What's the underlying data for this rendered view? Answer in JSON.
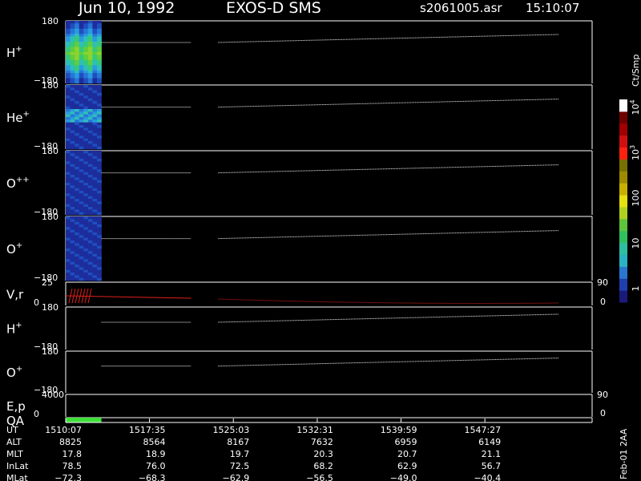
{
  "header": {
    "date": "Jun 10, 1992",
    "instrument": "EXOS-D SMS",
    "file": "s2061005.asr",
    "time": "15:10:07"
  },
  "chart_data": {
    "type": "heatmap",
    "panels": [
      {
        "label": "H",
        "sup": "+",
        "top_tick": "180",
        "bottom_tick": "−180"
      },
      {
        "label": "He",
        "sup": "+",
        "top_tick": "180",
        "bottom_tick": "−180"
      },
      {
        "label": "O",
        "sup": "++",
        "top_tick": "180",
        "bottom_tick": "−180"
      },
      {
        "label": "O",
        "sup": "+",
        "top_tick": "180",
        "bottom_tick": "−180"
      },
      {
        "label": "V,r",
        "sup": "",
        "top_tick": "25",
        "bottom_tick": "0",
        "right_top": "90",
        "right_bottom": "0"
      },
      {
        "label": "H",
        "sup": "+",
        "top_tick": "180",
        "bottom_tick": "−180"
      },
      {
        "label": "O",
        "sup": "+",
        "top_tick": "180",
        "bottom_tick": "−180"
      },
      {
        "label": "E,p",
        "sup": "",
        "top_tick": "4000",
        "bottom_tick": "0",
        "right_top": "90",
        "right_bottom": "0"
      },
      {
        "label": "QA",
        "sup": "",
        "top_tick": "",
        "bottom_tick": ""
      }
    ],
    "colorbar": {
      "unit": "Ct/Smp",
      "ticks": [
        {
          "value": 1,
          "label": "1"
        },
        {
          "value": 10,
          "label": "10"
        },
        {
          "value": 100,
          "label": "100"
        },
        {
          "value": 1000,
          "label": "10",
          "exp": "3"
        },
        {
          "value": 10000,
          "label": "10",
          "exp": "4"
        }
      ],
      "range": [
        0.5,
        15000
      ]
    },
    "time_axis": {
      "range_min": [
        1510.12,
        1557.0
      ],
      "data_range_min": [
        1510.12,
        1554.0
      ],
      "gap_min": [
        1521.3,
        1523.7
      ],
      "heatmap_end_min": [
        1510.12,
        1513.3
      ]
    },
    "ephemeris": {
      "rows": [
        "UT",
        "ALT",
        "MLT",
        "InLat",
        "MLat"
      ],
      "ticks_min": [
        1510.12,
        1517.58,
        1525.05,
        1532.52,
        1539.98,
        1547.45
      ],
      "columns": [
        {
          "UT": "1510:07",
          "ALT": "8825",
          "MLT": "17.8",
          "InLat": "78.5",
          "MLat": "−72.3"
        },
        {
          "UT": "1517:35",
          "ALT": "8564",
          "MLT": "18.9",
          "InLat": "76.0",
          "MLat": "−68.3"
        },
        {
          "UT": "1525:03",
          "ALT": "8167",
          "MLT": "19.7",
          "InLat": "72.5",
          "MLat": "−62.9"
        },
        {
          "UT": "1532:31",
          "ALT": "7632",
          "MLT": "20.3",
          "InLat": "68.2",
          "MLat": "−56.5"
        },
        {
          "UT": "1539:59",
          "ALT": "6959",
          "MLT": "20.7",
          "InLat": "62.9",
          "MLat": "−49.0"
        },
        {
          "UT": "1547:27",
          "ALT": "6149",
          "MLT": "21.1",
          "InLat": "56.7",
          "MLat": "−40.4"
        }
      ]
    },
    "footer": "Feb-01 2AA"
  }
}
